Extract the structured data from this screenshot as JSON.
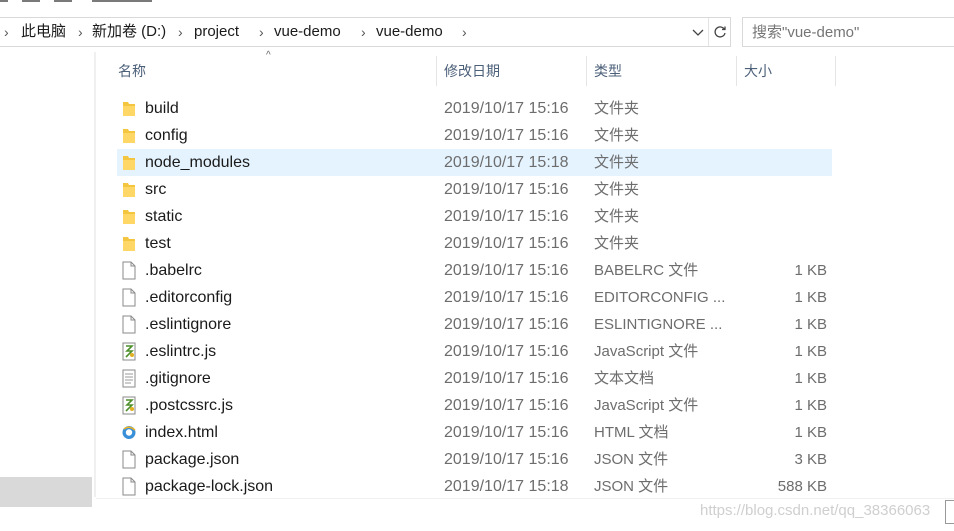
{
  "breadcrumb": [
    "此电脑",
    "新加卷 (D:)",
    "project",
    "vue-demo",
    "vue-demo"
  ],
  "search": {
    "placeholder": "搜索\"vue-demo\""
  },
  "columns": {
    "name": "名称",
    "date": "修改日期",
    "type": "类型",
    "size": "大小"
  },
  "files": [
    {
      "name": "build",
      "date": "2019/10/17 15:16",
      "type": "文件夹",
      "size": "",
      "icon": "folder-icon"
    },
    {
      "name": "config",
      "date": "2019/10/17 15:16",
      "type": "文件夹",
      "size": "",
      "icon": "folder-icon"
    },
    {
      "name": "node_modules",
      "date": "2019/10/17 15:18",
      "type": "文件夹",
      "size": "",
      "icon": "folder-icon",
      "selected": true
    },
    {
      "name": "src",
      "date": "2019/10/17 15:16",
      "type": "文件夹",
      "size": "",
      "icon": "folder-icon"
    },
    {
      "name": "static",
      "date": "2019/10/17 15:16",
      "type": "文件夹",
      "size": "",
      "icon": "folder-icon"
    },
    {
      "name": "test",
      "date": "2019/10/17 15:16",
      "type": "文件夹",
      "size": "",
      "icon": "folder-icon"
    },
    {
      "name": ".babelrc",
      "date": "2019/10/17 15:16",
      "type": "BABELRC 文件",
      "size": "1 KB",
      "icon": "file-icon"
    },
    {
      "name": ".editorconfig",
      "date": "2019/10/17 15:16",
      "type": "EDITORCONFIG ...",
      "size": "1 KB",
      "icon": "file-icon"
    },
    {
      "name": ".eslintignore",
      "date": "2019/10/17 15:16",
      "type": "ESLINTIGNORE ...",
      "size": "1 KB",
      "icon": "file-icon"
    },
    {
      "name": ".eslintrc.js",
      "date": "2019/10/17 15:16",
      "type": "JavaScript 文件",
      "size": "1 KB",
      "icon": "js-file-icon"
    },
    {
      "name": ".gitignore",
      "date": "2019/10/17 15:16",
      "type": "文本文档",
      "size": "1 KB",
      "icon": "text-file-icon"
    },
    {
      "name": ".postcssrc.js",
      "date": "2019/10/17 15:16",
      "type": "JavaScript 文件",
      "size": "1 KB",
      "icon": "js-file-icon"
    },
    {
      "name": "index.html",
      "date": "2019/10/17 15:16",
      "type": "HTML 文档",
      "size": "1 KB",
      "icon": "html-file-icon"
    },
    {
      "name": "package.json",
      "date": "2019/10/17 15:16",
      "type": "JSON 文件",
      "size": "3 KB",
      "icon": "file-icon"
    },
    {
      "name": "package-lock.json",
      "date": "2019/10/17 15:18",
      "type": "JSON 文件",
      "size": "588 KB",
      "icon": "file-icon"
    }
  ],
  "watermark": "https://blog.csdn.net/qq_38366063",
  "colors": {
    "folder": "#f4c53f",
    "selection": "#e5f3ff",
    "header_text": "#4c607a"
  }
}
